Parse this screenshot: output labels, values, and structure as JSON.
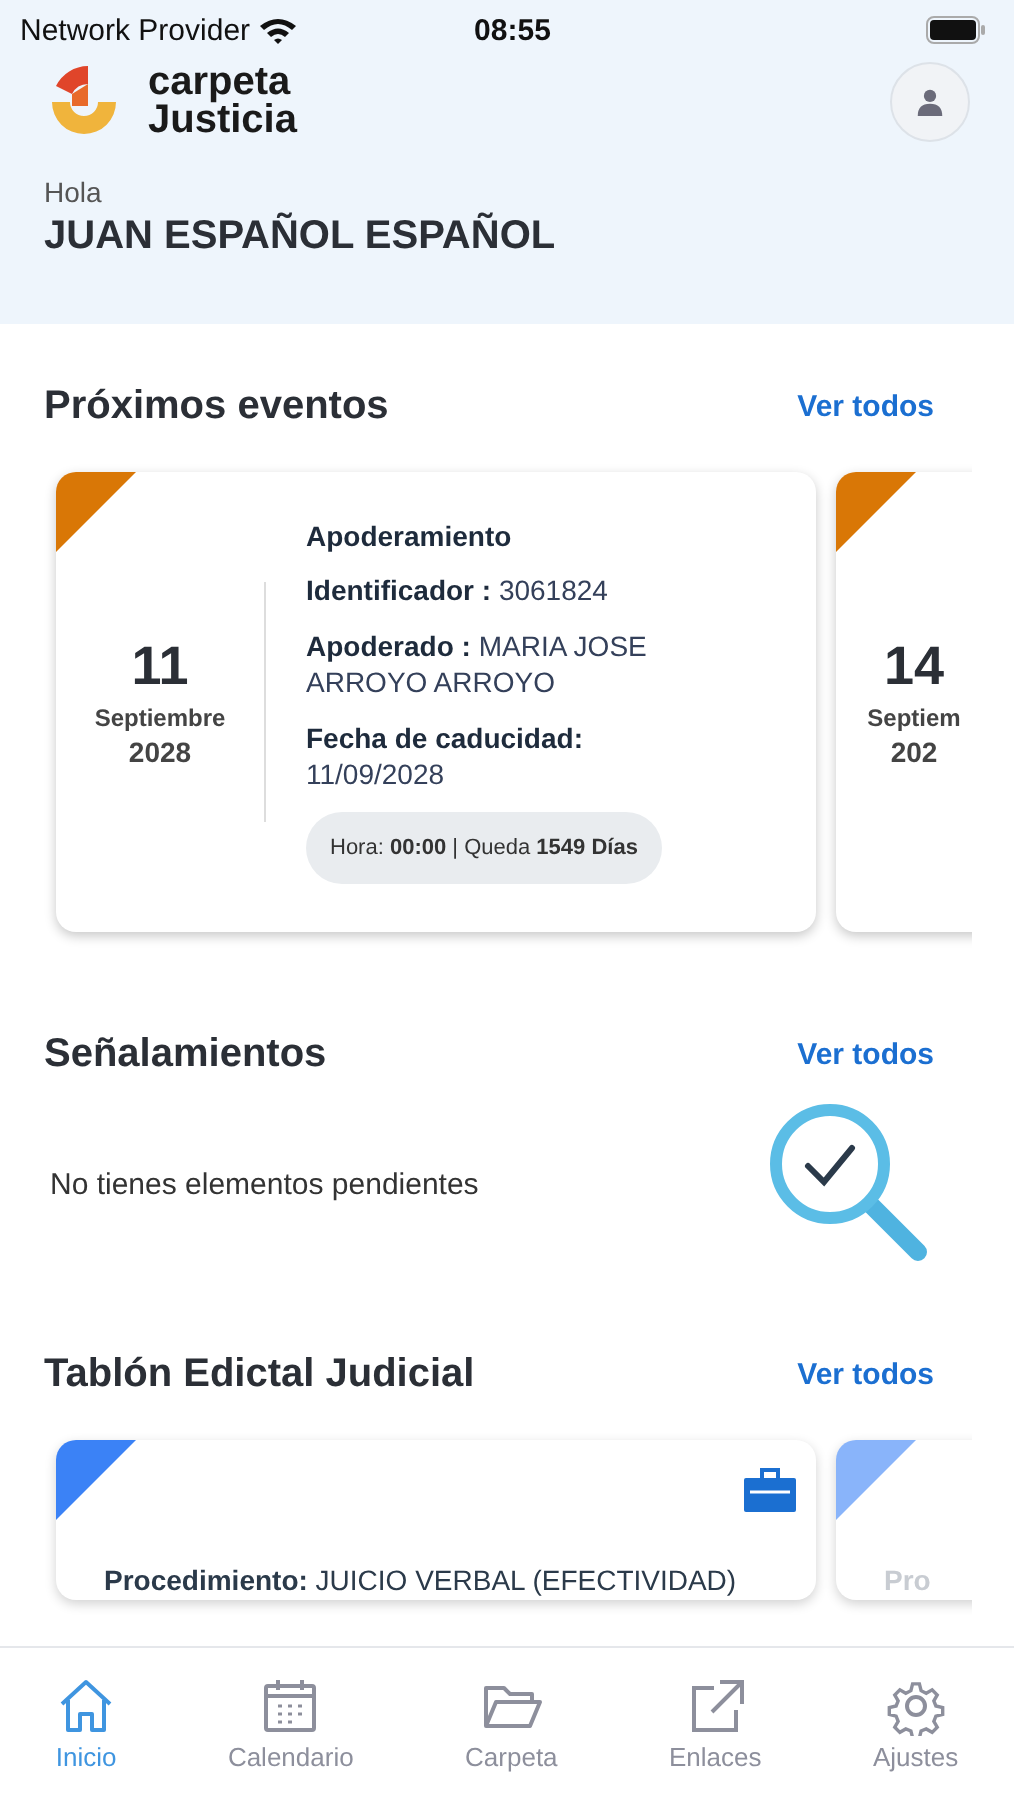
{
  "status_bar": {
    "carrier": "Network Provider",
    "time": "08:55"
  },
  "header": {
    "logo": [
      "carpeta",
      "Justicia"
    ],
    "greeting": "Hola",
    "user_name": "JUAN ESPAÑOL ESPAÑOL"
  },
  "events": {
    "title": "Próximos eventos",
    "link": "Ver todos",
    "cards": [
      {
        "day": "11",
        "month": "Septiembre",
        "year": "2028",
        "title": "Apoderamiento",
        "fields": [
          "**Identificador :** 3061824",
          "**Apoderado :** MARIA JOSE ARROYO ARROYO"
        ],
        "date_label": "Fecha de caducidad:",
        "date_value": "11/09/2028",
        "chip": "Hora: **00:00** | Queda **1549 Días**"
      },
      {
        "day": "14",
        "month": "Septiem",
        "year": "202"
      }
    ]
  },
  "hearings": {
    "title": "Señalamientos",
    "link": "Ver todos",
    "empty_message": "No tienes elementos pendientes"
  },
  "edicts": {
    "title": "Tablón Edictal Judicial",
    "link": "Ver todos",
    "cards": [
      {
        "text": "**Procedimiento:** JUICIO VERBAL (EFECTIVIDAD)",
        "faded": false
      },
      {
        "text": "Pro",
        "faded": true
      }
    ]
  },
  "tabs": [
    {
      "label": "Inicio",
      "kind": "home",
      "selected": true
    },
    {
      "label": "Calendario",
      "kind": "calendar",
      "selected": false
    },
    {
      "label": "Carpeta",
      "kind": "folder",
      "selected": false
    },
    {
      "label": "Enlaces",
      "kind": "external",
      "selected": false
    },
    {
      "label": "Ajustes",
      "kind": "gear",
      "selected": false
    }
  ]
}
